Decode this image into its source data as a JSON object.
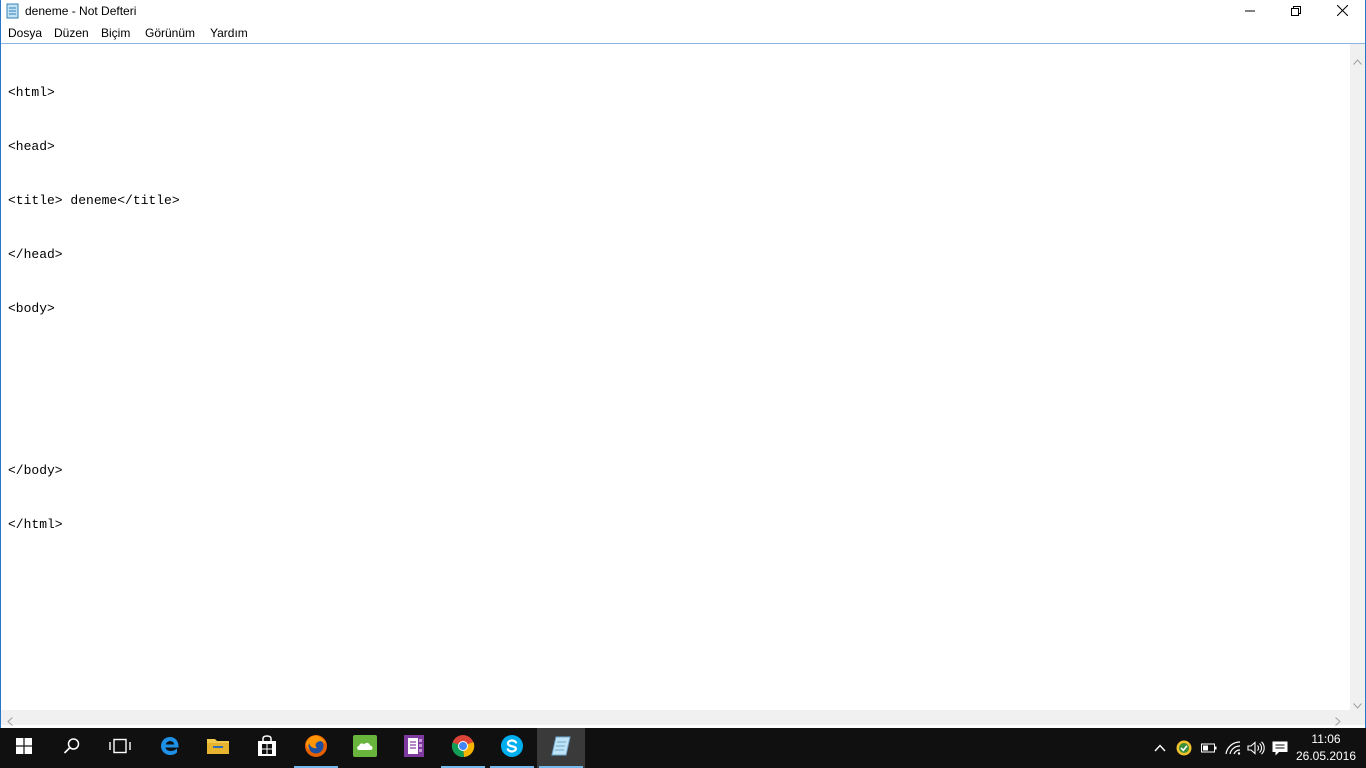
{
  "window": {
    "title": "deneme - Not Defteri",
    "controls": {
      "minimize_icon": "minimize-icon",
      "maximize_icon": "restore-icon",
      "close_icon": "close-icon"
    }
  },
  "menu": {
    "items": [
      "Dosya",
      "Düzen",
      "Biçim",
      "Görünüm",
      "Yardım"
    ]
  },
  "editor": {
    "lines": [
      "<html>",
      "<head>",
      "<title> deneme</title>",
      "</head>",
      "<body>",
      "",
      "",
      "</body>",
      "</html>"
    ]
  },
  "taskbar": {
    "apps": [
      {
        "name": "start",
        "icon": "windows-logo-icon"
      },
      {
        "name": "search",
        "icon": "search-icon"
      },
      {
        "name": "task-view",
        "icon": "task-view-icon"
      },
      {
        "name": "edge",
        "icon": "edge-icon"
      },
      {
        "name": "file-explorer",
        "icon": "folder-icon"
      },
      {
        "name": "store",
        "icon": "store-icon"
      },
      {
        "name": "firefox",
        "icon": "firefox-icon"
      },
      {
        "name": "cloud-app",
        "icon": "cloud-icon"
      },
      {
        "name": "onenote",
        "icon": "onenote-icon"
      },
      {
        "name": "chrome",
        "icon": "chrome-icon"
      },
      {
        "name": "skype",
        "icon": "skype-icon"
      },
      {
        "name": "notepad",
        "icon": "notepad-icon"
      }
    ],
    "tray": {
      "icons": [
        "chevron-up-icon",
        "shield-icon",
        "battery-icon",
        "wifi-icon",
        "volume-icon",
        "notifications-icon"
      ],
      "time": "11:06",
      "date": "26.05.2016"
    }
  },
  "colors": {
    "taskbar": "#101010",
    "accent": "#76b9ed",
    "window_border": "#2b77c7"
  }
}
